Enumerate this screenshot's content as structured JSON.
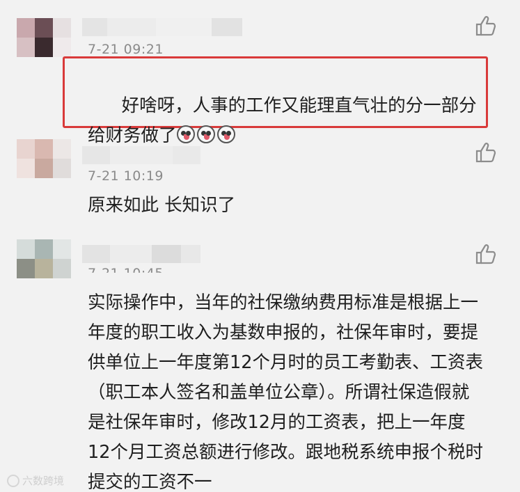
{
  "comments": [
    {
      "time": "7-21 09:21",
      "text": "好啥呀，人事的工作又能理直气壮的分一部分给财务做了",
      "emoji_count": 3,
      "highlighted": true
    },
    {
      "time": "7-21 10:19",
      "text": "原来如此 长知识了",
      "highlighted": false
    },
    {
      "time": "7-21 10:45",
      "text": "实际操作中，当年的社保缴纳费用标准是根据上一年度的职工收入为基数申报的，社保年审时，要提供单位上一年度第12个月时的员工考勤表、工资表（职工本人签名和盖单位公章）。所谓社保造假就是社保年审时，修改12月的工资表，把上一年度12个月工资总额进行修改。跟地税系统申报个税时提交的工资不一",
      "highlighted": false
    }
  ],
  "watermark": "六数跨境",
  "icons": {
    "like": "thumbs-up-icon",
    "emoji": "face-emoji-icon"
  },
  "colors": {
    "highlight_border": "#d93a3a",
    "timestamp": "#8a8a8a"
  }
}
